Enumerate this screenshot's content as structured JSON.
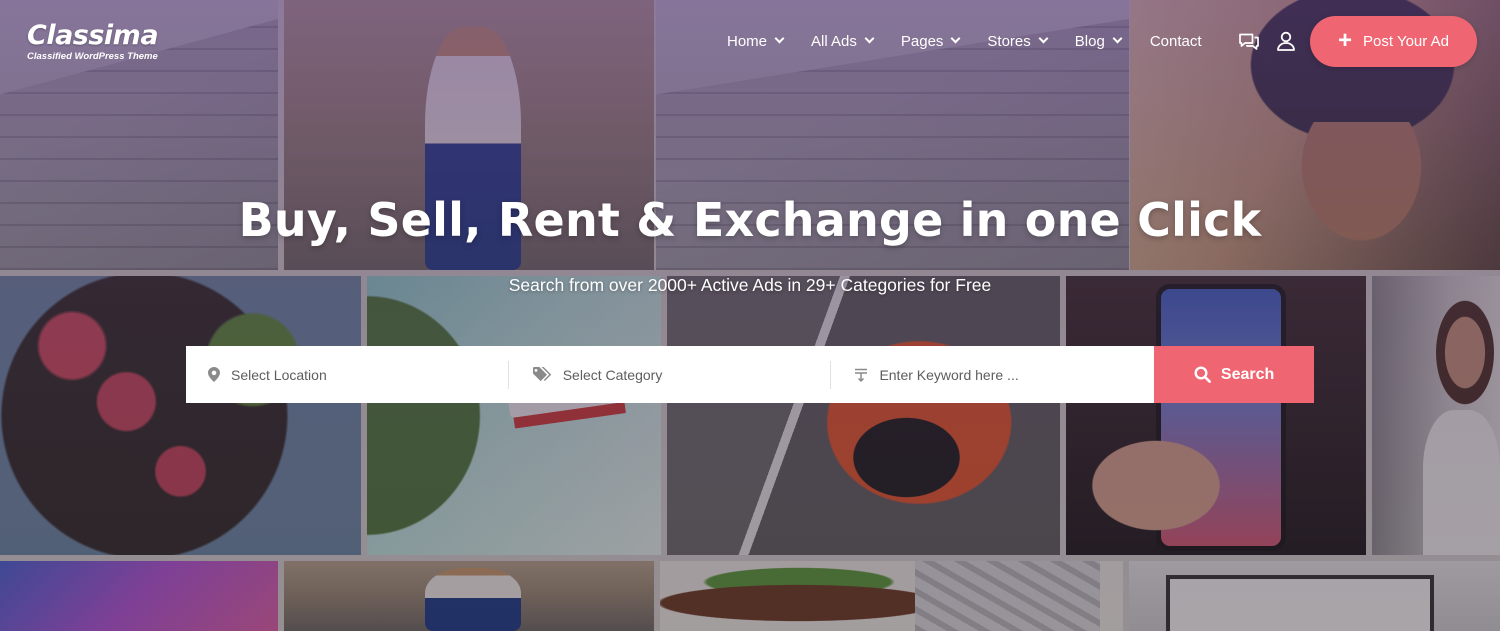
{
  "brand": {
    "logo_text": "Classima",
    "tagline": "Classified WordPress Theme"
  },
  "nav": {
    "items": [
      {
        "label": "Home",
        "has_dropdown": true
      },
      {
        "label": "All Ads",
        "has_dropdown": true
      },
      {
        "label": "Pages",
        "has_dropdown": true
      },
      {
        "label": "Stores",
        "has_dropdown": true
      },
      {
        "label": "Blog",
        "has_dropdown": true
      },
      {
        "label": "Contact",
        "has_dropdown": false
      }
    ],
    "icons": [
      "chat-icon",
      "user-icon"
    ],
    "post_button": "Post Your Ad"
  },
  "hero": {
    "title": "Buy, Sell, Rent & Exchange in one Click",
    "subtitle": "Search from over 2000+ Active Ads in 29+ Categories for Free"
  },
  "search": {
    "location_placeholder": "Select Location",
    "category_placeholder": "Select Category",
    "keyword_placeholder": "Enter Keyword here ...",
    "button_label": "Search"
  },
  "colors": {
    "accent": "#ef6672",
    "overlay": "#502d6e"
  }
}
